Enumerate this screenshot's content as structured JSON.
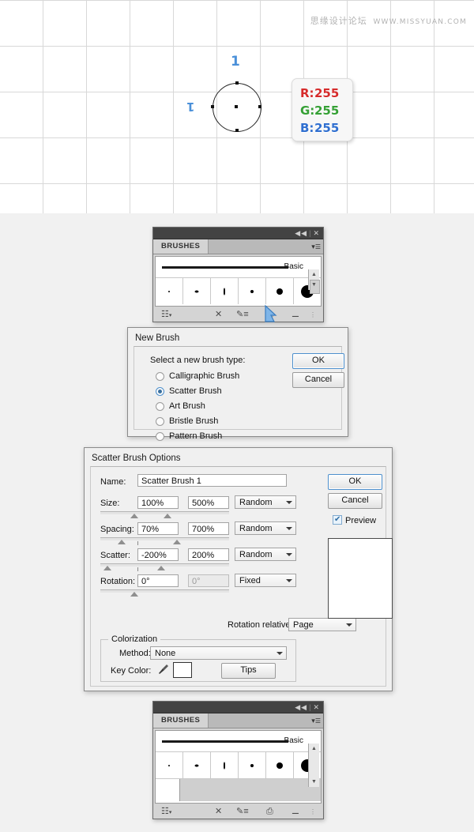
{
  "canvas": {
    "watermark_cn": "思缘设计论坛",
    "watermark_url": "WWW.MISSYUAN.COM",
    "label_top": "1",
    "label_left": "1",
    "color_readout": {
      "r_label": "R:",
      "r_value": "255",
      "g_label": "G:",
      "g_value": "255",
      "b_label": "B:",
      "b_value": "255",
      "r_color": "#d62b2b",
      "g_color": "#35a035",
      "b_color": "#2f6fd0"
    }
  },
  "brushes_panel_top": {
    "tab_label": "BRUSHES",
    "stroke_label": "Basic",
    "collapse_icon": "◀◀",
    "close_icon": "✕",
    "thumbnails": [
      {
        "name": "brush-1",
        "size": 2
      },
      {
        "name": "brush-2",
        "size": 5
      },
      {
        "name": "brush-3",
        "size": 3
      },
      {
        "name": "brush-4",
        "size": 4
      },
      {
        "name": "brush-5",
        "size": 8
      },
      {
        "name": "brush-6",
        "size": 16
      }
    ],
    "footer_icons": [
      {
        "name": "brush-libraries-icon",
        "glyph": "❐"
      },
      {
        "name": "remove-brush-link-icon",
        "glyph": "✕"
      },
      {
        "name": "options-of-selected-object-icon",
        "glyph": "✐"
      },
      {
        "name": "new-brush-icon",
        "glyph": "◳"
      },
      {
        "name": "delete-brush-icon",
        "glyph": "Ὕ1"
      }
    ],
    "has_empty_row": false
  },
  "brushes_panel_bottom": {
    "tab_label": "BRUSHES",
    "stroke_label": "Basic",
    "collapse_icon": "◀◀",
    "close_icon": "✕",
    "thumbnails": [
      {
        "name": "brush-1",
        "size": 2
      },
      {
        "name": "brush-2",
        "size": 5
      },
      {
        "name": "brush-3",
        "size": 3
      },
      {
        "name": "brush-4",
        "size": 4
      },
      {
        "name": "brush-5",
        "size": 8
      },
      {
        "name": "brush-6",
        "size": 16
      }
    ],
    "has_empty_row": true
  },
  "new_brush_dialog": {
    "title": "New Brush",
    "prompt": "Select a new brush type:",
    "options": [
      {
        "label": "Calligraphic Brush",
        "selected": false
      },
      {
        "label": "Scatter Brush",
        "selected": true
      },
      {
        "label": "Art Brush",
        "selected": false
      },
      {
        "label": "Bristle Brush",
        "selected": false
      },
      {
        "label": "Pattern Brush",
        "selected": false
      }
    ],
    "ok_label": "OK",
    "cancel_label": "Cancel"
  },
  "scatter_dialog": {
    "title": "Scatter Brush Options",
    "name_label": "Name:",
    "name_value": "Scatter Brush 1",
    "rows": [
      {
        "label": "Size:",
        "min": "100%",
        "max": "500%",
        "mode": "Random",
        "max_disabled": false
      },
      {
        "label": "Spacing:",
        "min": "70%",
        "max": "700%",
        "mode": "Random",
        "max_disabled": false
      },
      {
        "label": "Scatter:",
        "min": "-200%",
        "max": "200%",
        "mode": "Random",
        "max_disabled": false
      },
      {
        "label": "Rotation:",
        "min": "0°",
        "max": "0°",
        "mode": "Fixed",
        "max_disabled": true
      }
    ],
    "rotation_relative_label": "Rotation relative to:",
    "rotation_relative_value": "Page",
    "colorization_legend": "Colorization",
    "method_label": "Method:",
    "method_value": "None",
    "key_color_label": "Key Color:",
    "eyedropper_icon": "eyedropper-icon",
    "tips_label": "Tips",
    "ok_label": "OK",
    "cancel_label": "Cancel",
    "preview_label": "Preview",
    "preview_checked": true
  }
}
